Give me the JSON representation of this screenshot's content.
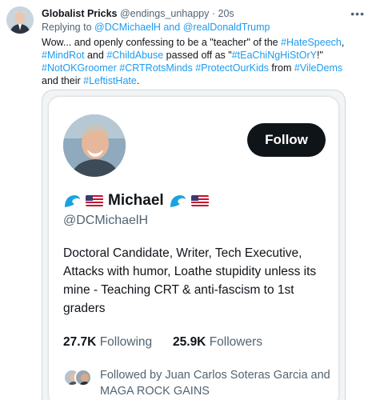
{
  "tweet": {
    "display_name": "Globalist Pricks",
    "handle": "@endings_unhappy",
    "separator": "·",
    "time": "20s",
    "more_icon": "more-horizontal-icon",
    "reply": {
      "prefix": "Replying to",
      "user1": "@DCMichaelH",
      "conjunction": "and",
      "user2": "@realDonaldTrump"
    },
    "text": {
      "t1": "Wow... and openly confessing to be a \"teacher\" of the ",
      "h1": "#HateSpeech",
      "t2": ", ",
      "h2": "#MindRot",
      "t3": " and ",
      "h3": "#ChildAbuse",
      "t4": " passed off as \"",
      "h4": "#tEaChiNgHiStOrY",
      "t5": "!\" ",
      "h5": "#NotOKGroomer",
      "t6": " ",
      "h6": "#CRTRotsMinds",
      "t7": " ",
      "h7": "#ProtectOurKids",
      "t8": " from ",
      "h8": "#VileDems",
      "t9": " and their ",
      "h9": "#LeftistHate",
      "t10": "."
    }
  },
  "profile_card": {
    "follow_label": "Follow",
    "name": "Michael",
    "handle": "@DCMichaelH",
    "bio": "Doctoral Candidate, Writer, Tech Executive, Attacks with humor, Loathe stupidity unless its mine - Teaching CRT & anti-fascism to 1st graders",
    "following_count": "27.7K",
    "following_label": "Following",
    "followers_count": "25.9K",
    "followers_label": "Followers",
    "followed_by": "Followed by Juan Carlos Soteras Garcia and MAGA ROCK GAINS"
  },
  "colors": {
    "link": "#1d9bf0",
    "text": "#0f1419",
    "secondary": "#536471",
    "follow_button_bg": "#0f1419"
  }
}
